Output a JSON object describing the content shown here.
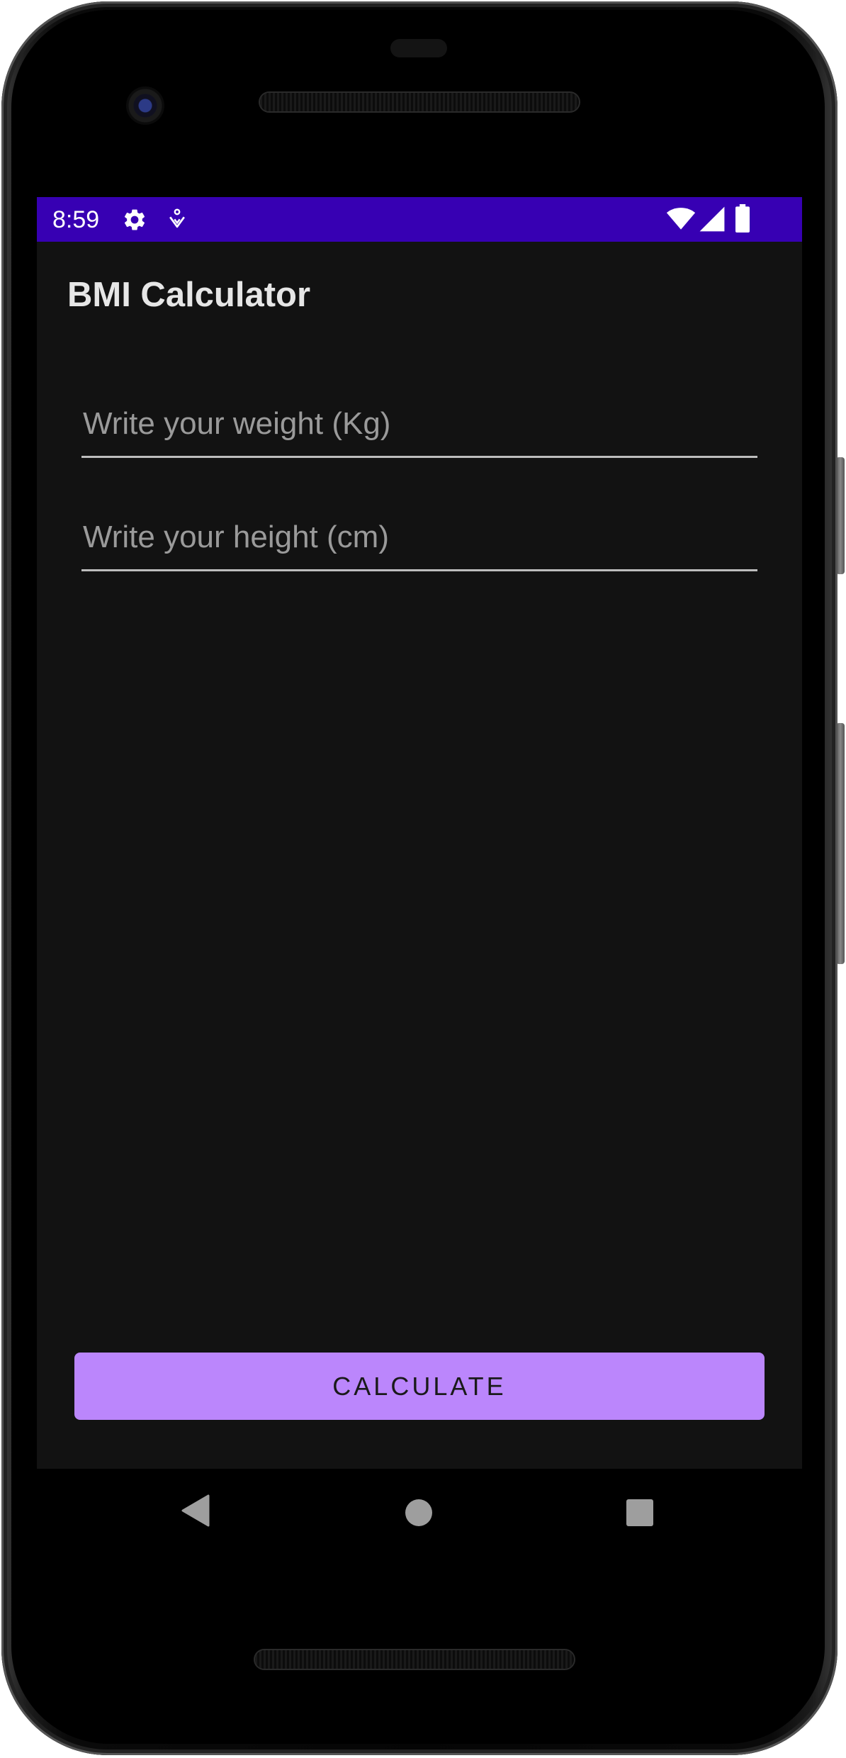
{
  "status_bar": {
    "time": "8:59",
    "icons": [
      "gear-icon",
      "accessibility-icon",
      "wifi-icon",
      "signal-icon",
      "battery-icon"
    ],
    "background_color": "#3700b3"
  },
  "app": {
    "title": "BMI Calculator",
    "background_color": "#121212"
  },
  "form": {
    "weight": {
      "value": "",
      "placeholder": "Write your weight (Kg)"
    },
    "height": {
      "value": "",
      "placeholder": "Write your height (cm)"
    }
  },
  "actions": {
    "calculate_label": "CALCULATE",
    "button_color": "#bb86fc"
  },
  "nav_bar": {
    "icons": [
      "back-icon",
      "home-icon",
      "recents-icon"
    ]
  }
}
